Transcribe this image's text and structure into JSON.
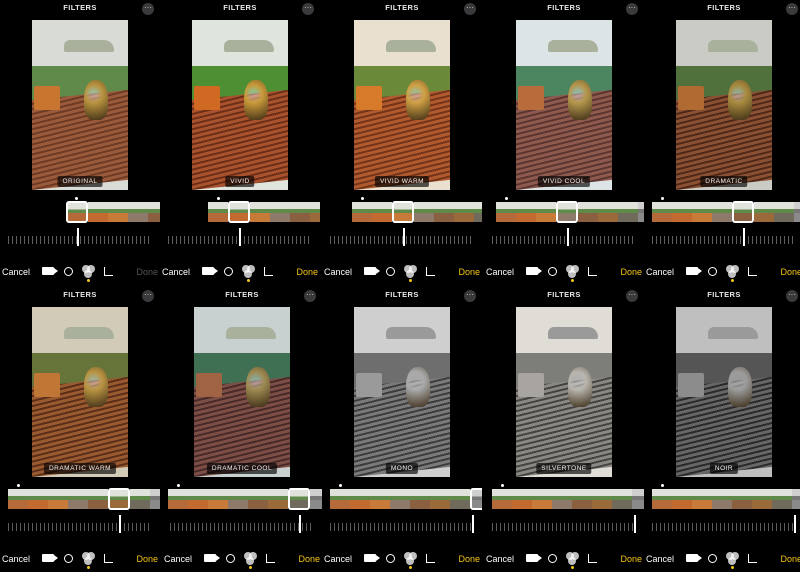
{
  "header_title": "FILTERS",
  "more_glyph": "···",
  "cancel_label": "Cancel",
  "done_label": "Done",
  "colors": {
    "done_active": "#f5c518",
    "done_inactive": "#555555",
    "text": "#ffffff",
    "background": "#000000"
  },
  "icons": [
    "video-icon",
    "adjust-icon",
    "filters-icon",
    "crop-icon"
  ],
  "panels": [
    {
      "label": "ORIGINAL",
      "done_enabled": false,
      "selected_index": 0
    },
    {
      "label": "VIVID",
      "done_enabled": true,
      "selected_index": 1
    },
    {
      "label": "VIVID WARM",
      "done_enabled": true,
      "selected_index": 2
    },
    {
      "label": "VIVID COOL",
      "done_enabled": true,
      "selected_index": 3
    },
    {
      "label": "DRAMATIC",
      "done_enabled": true,
      "selected_index": 4
    },
    {
      "label": "DRAMATIC WARM",
      "done_enabled": true,
      "selected_index": 5
    },
    {
      "label": "DRAMATIC COOL",
      "done_enabled": true,
      "selected_index": 6
    },
    {
      "label": "MONO",
      "done_enabled": true,
      "selected_index": 7
    },
    {
      "label": "SILVERTONE",
      "done_enabled": true,
      "selected_index": 8
    },
    {
      "label": "NOIR",
      "done_enabled": true,
      "selected_index": 9
    }
  ]
}
